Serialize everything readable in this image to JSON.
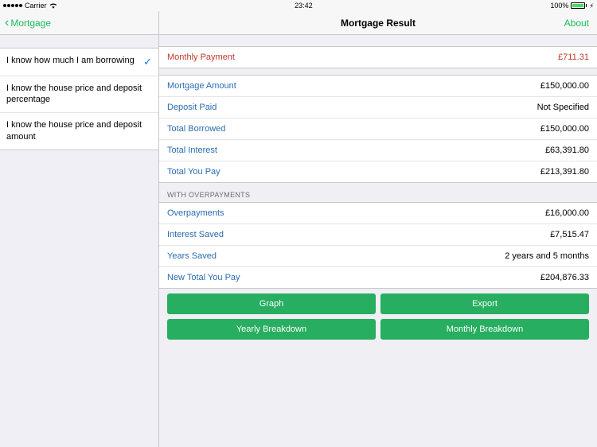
{
  "status": {
    "carrier": "Carrier",
    "time": "23:42",
    "battery_pct": "100%"
  },
  "sidebar": {
    "back_label": "Mortgage",
    "items": [
      {
        "label": "I know how much I am borrowing",
        "selected": true
      },
      {
        "label": "I know the house price and deposit percentage",
        "selected": false
      },
      {
        "label": "I know the house price and deposit amount",
        "selected": false
      }
    ]
  },
  "header": {
    "title": "Mortgage Result",
    "about": "About"
  },
  "summary": {
    "monthly_payment_label": "Monthly Payment",
    "monthly_payment_value": "£711.31",
    "rows": [
      {
        "label": "Mortgage Amount",
        "value": "£150,000.00"
      },
      {
        "label": "Deposit Paid",
        "value": "Not Specified"
      },
      {
        "label": "Total Borrowed",
        "value": "£150,000.00"
      },
      {
        "label": "Total Interest",
        "value": "£63,391.80"
      },
      {
        "label": "Total You Pay",
        "value": "£213,391.80"
      }
    ]
  },
  "overpayments": {
    "header": "WITH OVERPAYMENTS",
    "rows": [
      {
        "label": "Overpayments",
        "value": "£16,000.00"
      },
      {
        "label": "Interest Saved",
        "value": "£7,515.47"
      },
      {
        "label": "Years Saved",
        "value": "2 years and 5 months"
      },
      {
        "label": "New Total You Pay",
        "value": "£204,876.33"
      }
    ]
  },
  "buttons": {
    "graph": "Graph",
    "export": "Export",
    "yearly": "Yearly Breakdown",
    "monthly": "Monthly Breakdown"
  }
}
